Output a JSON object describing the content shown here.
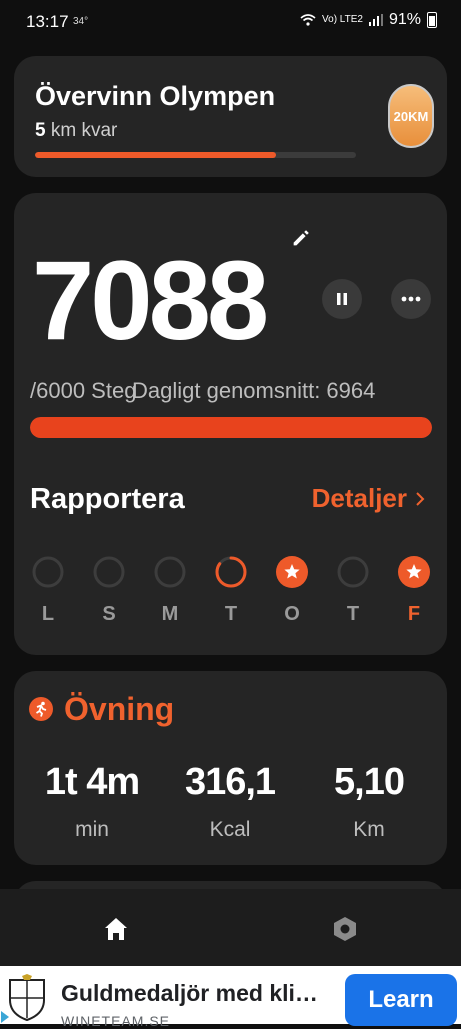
{
  "status_bar": {
    "time": "13:17",
    "temperature": "34°",
    "network": "Vo) LTE2",
    "battery": "91%"
  },
  "goal": {
    "title": "Övervinn Olympen",
    "remaining_value": "5",
    "remaining_label": "km kvar",
    "progress": 0.75,
    "badge": "20KM"
  },
  "steps": {
    "count": "7088",
    "goal": "/6000 Steg",
    "average": "Dagligt genomsnitt: 6964",
    "progress": 1.0
  },
  "report": {
    "title": "Rapportera",
    "details": "Detaljer",
    "days": [
      {
        "label": "L",
        "state": "empty"
      },
      {
        "label": "S",
        "state": "empty"
      },
      {
        "label": "M",
        "state": "empty"
      },
      {
        "label": "T",
        "state": "partial",
        "progress": 0.85
      },
      {
        "label": "O",
        "state": "achieved"
      },
      {
        "label": "T",
        "state": "empty"
      },
      {
        "label": "F",
        "state": "achieved",
        "today": true
      }
    ]
  },
  "exercise": {
    "title": "Övning",
    "stats": [
      {
        "value": "1t 4m",
        "unit": "min"
      },
      {
        "value": "316,1",
        "unit": "Kcal"
      },
      {
        "value": "5,10",
        "unit": "Km"
      }
    ]
  },
  "ad": {
    "title": "Guldmedaljör med kli…",
    "source": "WINETEAM.SE",
    "button": "Learn"
  },
  "colors": {
    "accent": "#ee5a2a",
    "card": "#252525",
    "background": "#0f0f0f"
  }
}
